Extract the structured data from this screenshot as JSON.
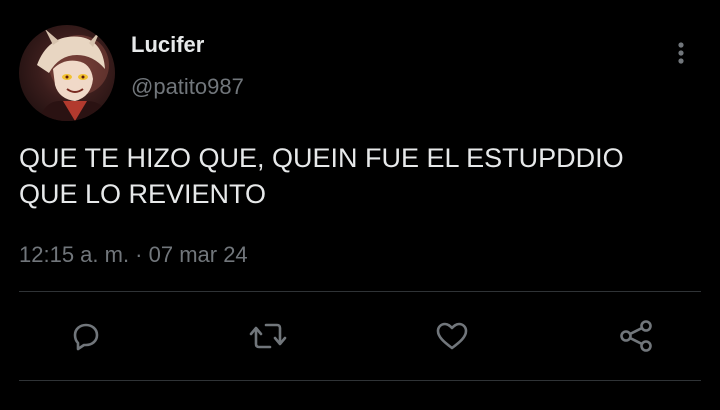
{
  "tweet": {
    "author": {
      "display_name": "Lucifer",
      "handle": "@patito987",
      "avatar_icon": "character-avatar"
    },
    "text_lines": [
      "QUE TE HIZO QUE, QUEIN FUE EL ESTUPDDIO",
      "QUE LO REVIENTO"
    ],
    "timestamp": "12:15 a. m. · 07 mar 24",
    "more_icon": "more-vertical-icon",
    "actions": [
      {
        "name": "reply",
        "icon": "reply-icon"
      },
      {
        "name": "retweet",
        "icon": "retweet-icon"
      },
      {
        "name": "like",
        "icon": "heart-icon"
      },
      {
        "name": "share",
        "icon": "share-icon"
      }
    ]
  },
  "colors": {
    "background": "#000000",
    "primary_text": "#e7e9ea",
    "secondary_text": "#71767b",
    "divider": "#2f3336",
    "icon": "#71767b"
  }
}
